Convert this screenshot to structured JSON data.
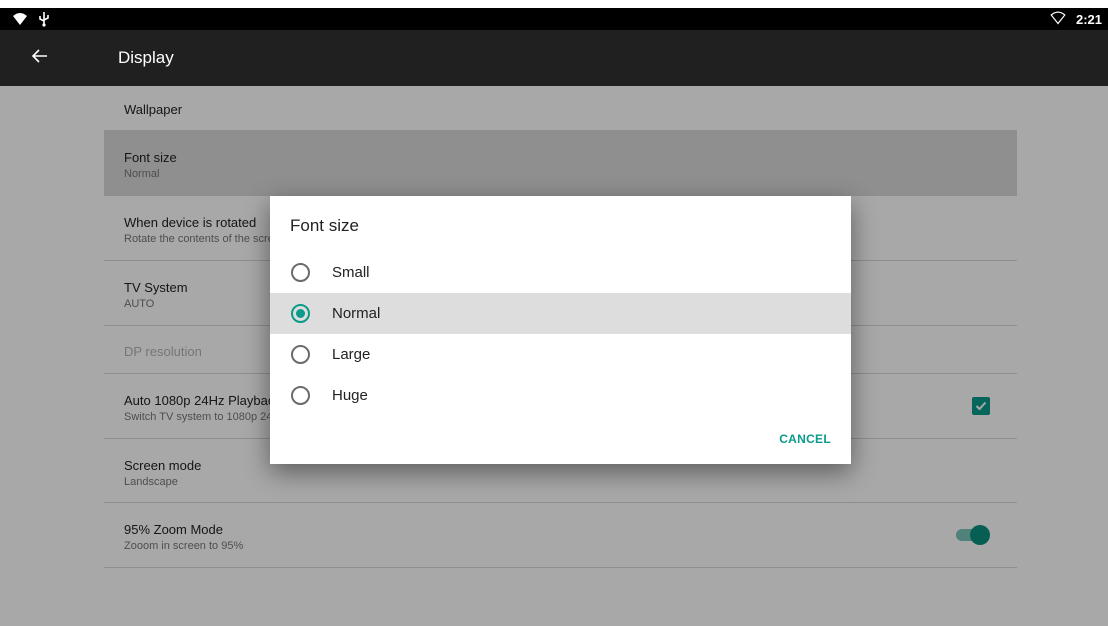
{
  "status_bar": {
    "left_icons": [
      "wifi-signal-icon",
      "usb-icon"
    ],
    "right_icons": [
      "wifi-outline-icon"
    ],
    "time": "2:21"
  },
  "app_bar": {
    "title": "Display"
  },
  "settings": {
    "items": [
      {
        "title": "Wallpaper",
        "summary": ""
      },
      {
        "title": "Font size",
        "summary": "Normal"
      },
      {
        "title": "When device is rotated",
        "summary": "Rotate the contents of the screen"
      },
      {
        "title": "TV System",
        "summary": "AUTO"
      },
      {
        "title": "DP resolution",
        "summary": ""
      },
      {
        "title": "Auto 1080p 24Hz Playback",
        "summary": "Switch TV system to 1080p 24Hz",
        "checked": true
      },
      {
        "title": "Screen mode",
        "summary": "Landscape"
      },
      {
        "title": "95% Zoom Mode",
        "summary": "Zooom in screen to 95%",
        "enabled": true
      }
    ]
  },
  "dialog": {
    "title": "Font size",
    "options": [
      {
        "label": "Small",
        "checked": false
      },
      {
        "label": "Normal",
        "checked": true
      },
      {
        "label": "Large",
        "checked": false
      },
      {
        "label": "Huge",
        "checked": false
      }
    ],
    "cancel_label": "CANCEL"
  },
  "colors": {
    "accent": "#0a9b8a",
    "app_bar": "#202020",
    "status_bar": "#000000"
  }
}
